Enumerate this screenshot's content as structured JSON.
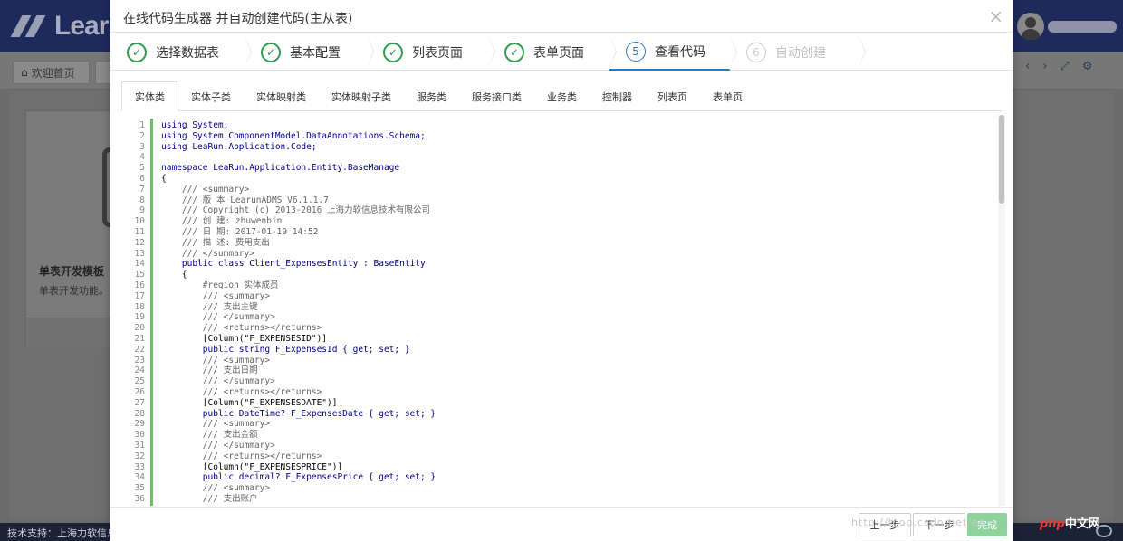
{
  "app": {
    "logo_text": "Learu",
    "home_tab": "欢迎首页",
    "card_title": "单表开发模板",
    "card_desc": "单表开发功能。",
    "footer": "技术支持：上海力软信息"
  },
  "modal": {
    "title": "在线代码生成器 并自动创建代码(主从表)",
    "close": "×",
    "steps": [
      {
        "num": "✓",
        "label": "选择数据表",
        "state": "done"
      },
      {
        "num": "✓",
        "label": "基本配置",
        "state": "done"
      },
      {
        "num": "✓",
        "label": "列表页面",
        "state": "done"
      },
      {
        "num": "✓",
        "label": "表单页面",
        "state": "done"
      },
      {
        "num": "5",
        "label": "查看代码",
        "state": "current"
      },
      {
        "num": "6",
        "label": "自动创建",
        "state": "pending"
      }
    ],
    "code_tabs": [
      "实体类",
      "实体子类",
      "实体映射类",
      "实体映射子类",
      "服务类",
      "服务接口类",
      "业务类",
      "控制器",
      "列表页",
      "表单页"
    ],
    "active_tab": 0,
    "code_lines": [
      "using System;",
      "using System.ComponentModel.DataAnnotations.Schema;",
      "using LeaRun.Application.Code;",
      "",
      "namespace LeaRun.Application.Entity.BaseManage",
      "{",
      "    /// <summary>",
      "    /// 版 本 LearunADMS V6.1.1.7",
      "    /// Copyright (c) 2013-2016 上海力软信息技术有限公司",
      "    /// 创 建: zhuwenbin",
      "    /// 日 期: 2017-01-19 14:52",
      "    /// 描 述: 费用支出",
      "    /// </summary>",
      "    public class Client_ExpensesEntity : BaseEntity",
      "    {",
      "        #region 实体成员",
      "        /// <summary>",
      "        /// 支出主键",
      "        /// </summary>",
      "        /// <returns></returns>",
      "        [Column(\"F_EXPENSESID\")]",
      "        public string F_ExpensesId { get; set; }",
      "        /// <summary>",
      "        /// 支出日期",
      "        /// </summary>",
      "        /// <returns></returns>",
      "        [Column(\"F_EXPENSESDATE\")]",
      "        public DateTime? F_ExpensesDate { get; set; }",
      "        /// <summary>",
      "        /// 支出金额",
      "        /// </summary>",
      "        /// <returns></returns>",
      "        [Column(\"F_EXPENSESPRICE\")]",
      "        public decimal? F_ExpensesPrice { get; set; }",
      "        /// <summary>",
      "        /// 支出账户"
    ],
    "buttons": {
      "prev": "上一步",
      "next": "下一步",
      "finish": "完成"
    }
  },
  "watermark": "http://blog.csdn.net/en",
  "php_badge": {
    "php": "php",
    "text": "中文网"
  }
}
